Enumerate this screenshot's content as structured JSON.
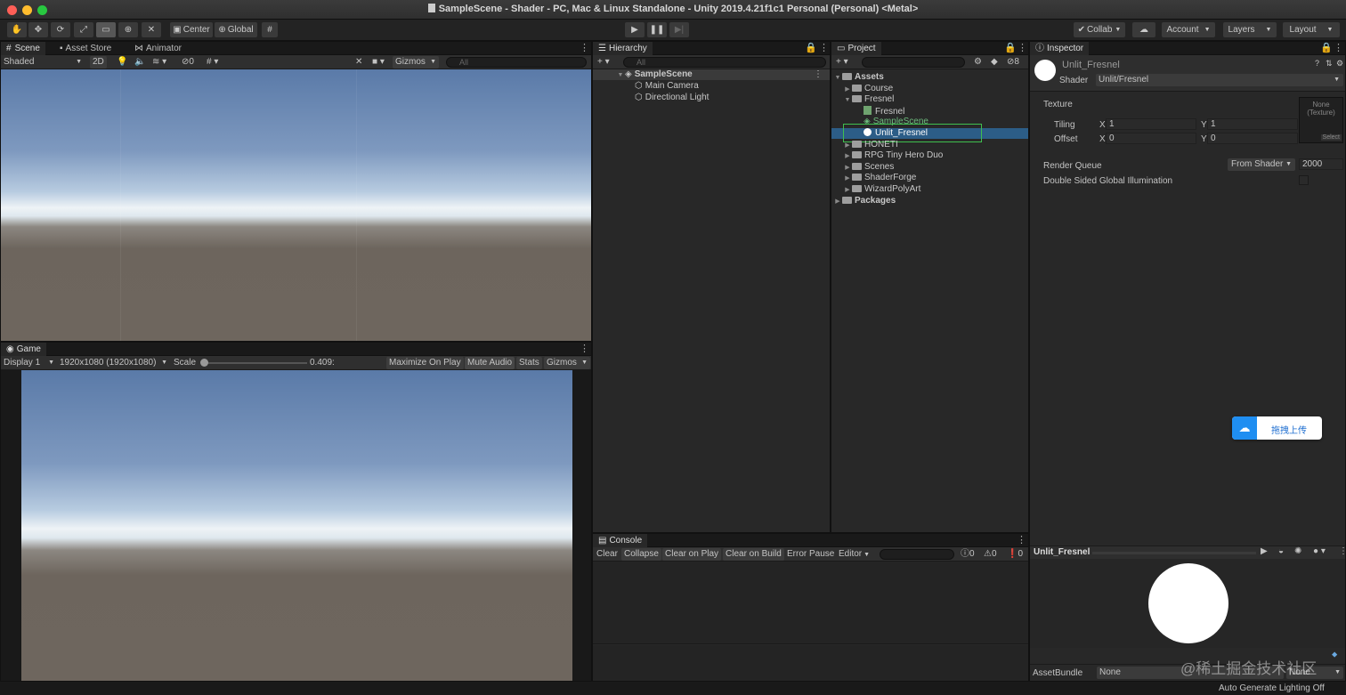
{
  "window": {
    "title": "SampleScene - Shader - PC, Mac & Linux Standalone - Unity 2019.4.21f1c1 Personal (Personal) <Metal>"
  },
  "toolbar": {
    "pivot_label": "Center",
    "space_label": "Global",
    "collab_label": "Collab",
    "account_label": "Account",
    "layers_label": "Layers",
    "layout_label": "Layout"
  },
  "scene_panel": {
    "tabs": [
      "Scene",
      "Asset Store",
      "Animator"
    ],
    "shading_mode": "Shaded",
    "mode_2d": "2D",
    "hidden_count": "0",
    "gizmos_label": "Gizmos",
    "search_placeholder": "All"
  },
  "game_panel": {
    "tab": "Game",
    "display": "Display 1",
    "resolution": "1920x1080 (1920x1080)",
    "scale_label": "Scale",
    "scale_value": "0.409:",
    "maximize_label": "Maximize On Play",
    "mute_label": "Mute Audio",
    "stats_label": "Stats",
    "gizmos_label": "Gizmos"
  },
  "hierarchy": {
    "tab": "Hierarchy",
    "search_placeholder": "All",
    "scene_name": "SampleScene",
    "items": [
      "Main Camera",
      "Directional Light"
    ]
  },
  "project": {
    "tab": "Project",
    "hidden_count": "8",
    "tree": {
      "assets": "Assets",
      "course": "Course",
      "fresnel_folder": "Fresnel",
      "fresnel_shader": "Fresnel",
      "sample_scene": "SampleScene",
      "unlit_fresnel": "Unlit_Fresnel",
      "honeti": "HONETI",
      "rpg": "RPG Tiny Hero Duo",
      "scenes": "Scenes",
      "shaderforge": "ShaderForge",
      "wizard": "WizardPolyArt",
      "packages": "Packages"
    }
  },
  "console": {
    "tab": "Console",
    "clear": "Clear",
    "collapse": "Collapse",
    "clear_on_play": "Clear on Play",
    "clear_on_build": "Clear on Build",
    "error_pause": "Error Pause",
    "editor": "Editor",
    "log_count": "0",
    "warn_count": "0",
    "error_count": "0"
  },
  "inspector": {
    "tab": "Inspector",
    "material_name": "Unlit_Fresnel",
    "shader_label": "Shader",
    "shader_value": "Unlit/Fresnel",
    "texture_label": "Texture",
    "texture_slot": "None\n(Texture)",
    "select_label": "Select",
    "tiling_label": "Tiling",
    "offset_label": "Offset",
    "x_label": "X",
    "y_label": "Y",
    "tiling_x": "1",
    "tiling_y": "1",
    "offset_x": "0",
    "offset_y": "0",
    "render_queue_label": "Render Queue",
    "render_queue_mode": "From Shader",
    "render_queue_value": "2000",
    "double_sided_label": "Double Sided Global Illumination",
    "preview_name": "Unlit_Fresnel",
    "assetbundle_label": "AssetBundle",
    "assetbundle_value": "None",
    "assetbundle_variant": "None"
  },
  "overlay": {
    "upload_label": "拖拽上传",
    "watermark": "@稀土掘金技术社区"
  },
  "status": {
    "text": "Auto Generate Lighting Off"
  },
  "colors": {
    "selection": "#2c5d87",
    "highlight_box": "#3fbf4f",
    "upload_blue": "#1f8ef1"
  }
}
